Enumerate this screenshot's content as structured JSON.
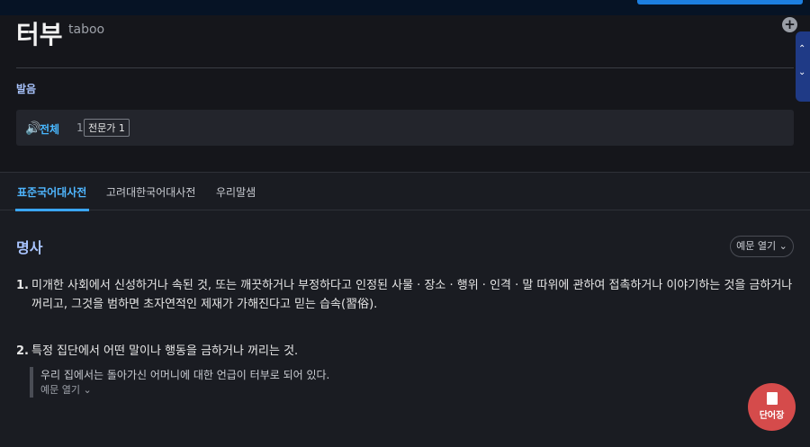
{
  "header": {
    "word": "터부",
    "original": "taboo",
    "add_icon": "plus-circle-icon",
    "pronunciation_label": "발음",
    "pronunciation": {
      "all_label": "전체",
      "all_count": "1",
      "expert_label": "전문가",
      "expert_count": "1"
    }
  },
  "side_nav": {
    "up_icon": "chevron-up-icon",
    "down_icon": "chevron-down-icon"
  },
  "tabs": [
    {
      "label": "표준국어대사전",
      "active": true
    },
    {
      "label": "고려대한국어대사전",
      "active": false
    },
    {
      "label": "우리말샘",
      "active": false
    }
  ],
  "entry": {
    "pos": "명사",
    "example_toggle": "예문 열기",
    "definitions": [
      {
        "num": "1.",
        "text": "미개한 사회에서 신성하거나 속된 것, 또는 깨끗하거나 부정하다고 인정된 사물 · 장소 · 행위 · 인격 · 말 따위에 관하여 접촉하거나 이야기하는 것을 금하거나 꺼리고, 그것을 범하면 초자연적인 제재가 가해진다고 믿는 습속(習俗)."
      },
      {
        "num": "2.",
        "text": "특정 집단에서 어떤 말이나 행동을 금하거나 꺼리는 것."
      }
    ],
    "example_text": "우리 집에서는 돌아가신 어머니에 대한 언급이 터부로 되어 있다.",
    "example_more": "예문 열기"
  },
  "fab": {
    "label": "단어장",
    "icon": "wordbook-icon"
  },
  "colors": {
    "accent": "#4fb6ff",
    "fab": "#d54b4b",
    "pos": "#a9c4ff"
  }
}
